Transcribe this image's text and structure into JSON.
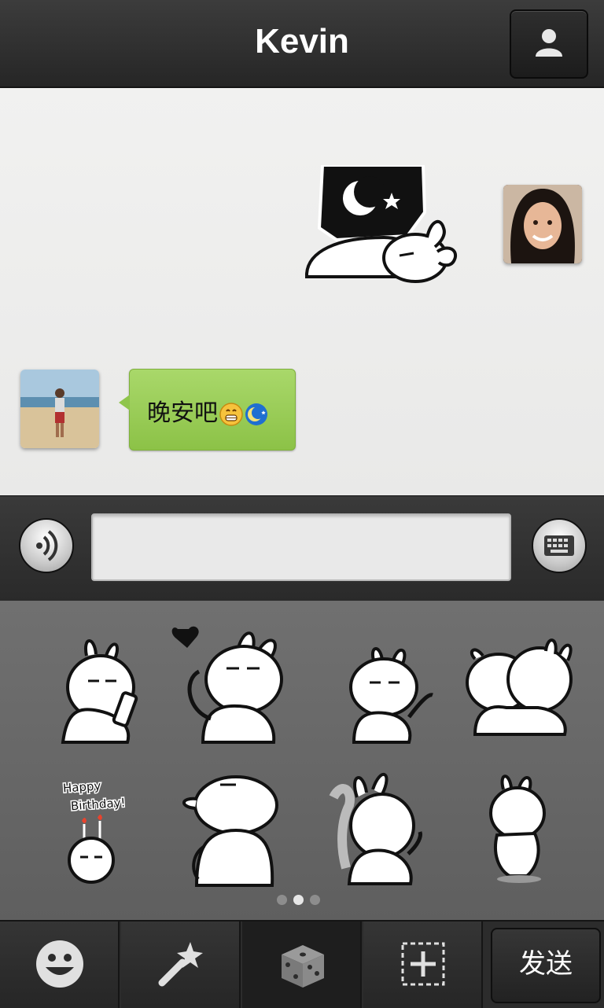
{
  "header": {
    "title": "Kevin",
    "profile_icon": "person-icon"
  },
  "chat": {
    "messages": [
      {
        "side": "right",
        "type": "sticker",
        "sticker": "goodnight-moon-rabbit-sticker"
      },
      {
        "side": "left",
        "type": "text",
        "text": "晚安吧",
        "emojis": [
          "grin-emoji",
          "moon-emoji"
        ]
      }
    ]
  },
  "input": {
    "value": "",
    "placeholder": ""
  },
  "sticker_panel": {
    "stickers": [
      "rabbit-drinking-sticker",
      "rabbit-heart-sticker",
      "rabbit-pointing-sticker",
      "rabbit-kiss-sticker",
      "happy-birthday-rabbit-sticker",
      "rabbit-back-sticker",
      "rabbit-dancing-sticker",
      "rabbit-walking-sticker"
    ],
    "happy_birthday_text": "Happy Birthday!",
    "page_count": 3,
    "current_page": 2
  },
  "tabbar": {
    "tabs": [
      "smiley-icon",
      "magic-wand-icon",
      "dice-icon",
      "add-icon"
    ],
    "selected_tab": 2,
    "send_label": "发送"
  },
  "colors": {
    "bubble_green": "#9fd05c",
    "header_bg": "#2f2f2f",
    "panel_bg": "#666666"
  }
}
